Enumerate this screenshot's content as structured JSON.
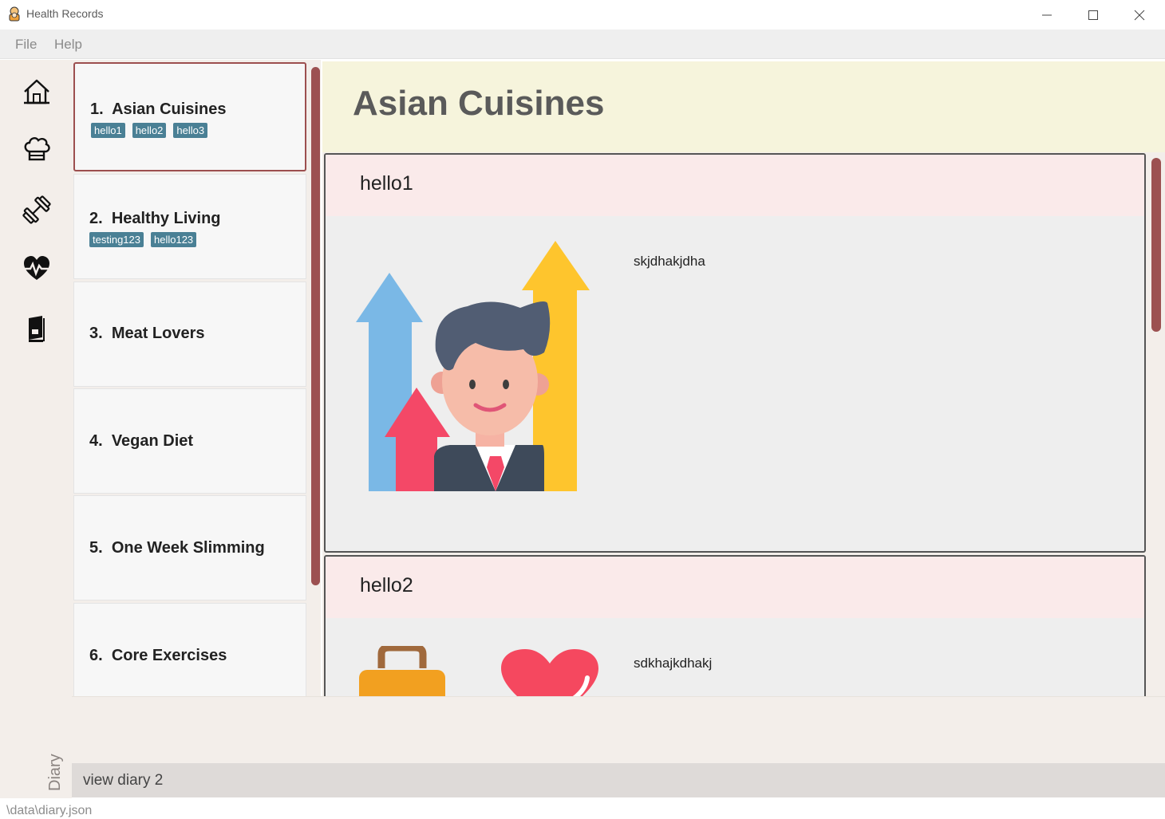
{
  "window": {
    "title": "Health Records"
  },
  "menu": {
    "items": [
      "File",
      "Help"
    ]
  },
  "sidebar": {
    "icons": [
      "home-icon",
      "chef-hat-icon",
      "dumbbell-icon",
      "heartbeat-icon",
      "diary-book-icon"
    ],
    "section_label": "Diary"
  },
  "diary_list": [
    {
      "index": "1.",
      "name": "Asian Cuisines",
      "tags": [
        "hello1",
        "hello2",
        "hello3"
      ]
    },
    {
      "index": "2.",
      "name": "Healthy Living",
      "tags": [
        "testing123",
        "hello123"
      ]
    },
    {
      "index": "3.",
      "name": "Meat Lovers",
      "tags": []
    },
    {
      "index": "4.",
      "name": "Vegan Diet",
      "tags": []
    },
    {
      "index": "5.",
      "name": "One Week Slimming",
      "tags": []
    },
    {
      "index": "6.",
      "name": "Core Exercises",
      "tags": []
    }
  ],
  "detail": {
    "title": "Asian Cuisines",
    "entries": [
      {
        "title": "hello1",
        "text": "skjdhakjdha"
      },
      {
        "title": "hello2",
        "text": "sdkhajkdhakj"
      }
    ]
  },
  "command": {
    "value": "view diary 2"
  },
  "status": {
    "path": "\\data\\diary.json"
  },
  "colors": {
    "accent": "#9c5151",
    "tag": "#4a8095",
    "header_bg": "#f6f4dc",
    "entry_head_bg": "#faeaea"
  }
}
